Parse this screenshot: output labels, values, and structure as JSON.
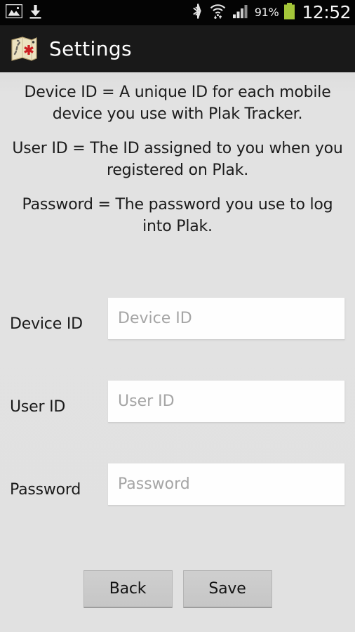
{
  "status_bar": {
    "left_icons": [
      {
        "name": "screenshot-image-icon",
        "label": "screenshot"
      },
      {
        "name": "download-icon",
        "label": "download"
      }
    ],
    "right_icons": [
      {
        "name": "bluetooth-icon",
        "label": "bluetooth"
      },
      {
        "name": "wifi-icon",
        "label": "wifi with data transfer"
      },
      {
        "name": "cellular-signal-icon",
        "label": "cellular signal"
      }
    ],
    "battery_percent": "91%",
    "clock": "12:52",
    "background": "#040404",
    "battery_color": "#a4c639"
  },
  "title_bar": {
    "icon_name": "plak-map-icon",
    "title": "Settings",
    "background": "#191919",
    "text_color": "#fdfdfd"
  },
  "intro": {
    "paragraphs": [
      "Device ID = A unique ID for each mobile device you use with Plak Tracker.",
      "User ID = The ID assigned to you when you registered on Plak.",
      "Password = The password you use to log into Plak."
    ]
  },
  "form": {
    "fields": [
      {
        "name": "device-id",
        "label": "Device ID",
        "placeholder": "Device ID",
        "value": ""
      },
      {
        "name": "user-id",
        "label": "User ID",
        "placeholder": "User ID",
        "value": ""
      },
      {
        "name": "password",
        "label": "Password",
        "placeholder": "Password",
        "value": ""
      }
    ]
  },
  "buttons": {
    "back_label": "Back",
    "save_label": "Save"
  },
  "theme": {
    "page_background": "#e1e1e1",
    "input_background": "#fefefe",
    "placeholder_color": "#a5a5a5",
    "button_background": "#cbcbcb",
    "text_color": "#1a1a1a"
  }
}
